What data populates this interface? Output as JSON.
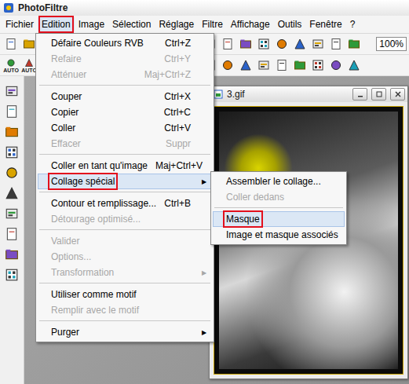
{
  "window": {
    "title": "PhotoFiltre"
  },
  "menubar": [
    {
      "label": "Fichier",
      "selected": false,
      "annotated": false
    },
    {
      "label": "Edition",
      "selected": true,
      "annotated": true
    },
    {
      "label": "Image",
      "selected": false,
      "annotated": false
    },
    {
      "label": "Sélection",
      "selected": false,
      "annotated": false
    },
    {
      "label": "Réglage",
      "selected": false,
      "annotated": false
    },
    {
      "label": "Filtre",
      "selected": false,
      "annotated": false
    },
    {
      "label": "Affichage",
      "selected": false,
      "annotated": false
    },
    {
      "label": "Outils",
      "selected": false,
      "annotated": false
    },
    {
      "label": "Fenêtre",
      "selected": false,
      "annotated": false
    },
    {
      "label": "?",
      "selected": false,
      "annotated": false
    }
  ],
  "zoom": {
    "value": "100%"
  },
  "toolbar2_badges": [
    "AUTO",
    "AUTO"
  ],
  "edit_menu": [
    {
      "kind": "item",
      "label": "Défaire Couleurs RVB",
      "shortcut": "Ctrl+Z",
      "disabled": false,
      "selected": false,
      "annotated": false
    },
    {
      "kind": "item",
      "label": "Refaire",
      "shortcut": "Ctrl+Y",
      "disabled": true,
      "selected": false,
      "annotated": false
    },
    {
      "kind": "item",
      "label": "Atténuer",
      "shortcut": "Maj+Ctrl+Z",
      "disabled": true,
      "selected": false,
      "annotated": false
    },
    {
      "kind": "separator"
    },
    {
      "kind": "item",
      "label": "Couper",
      "shortcut": "Ctrl+X",
      "disabled": false,
      "selected": false,
      "annotated": false
    },
    {
      "kind": "item",
      "label": "Copier",
      "shortcut": "Ctrl+C",
      "disabled": false,
      "selected": false,
      "annotated": false
    },
    {
      "kind": "item",
      "label": "Coller",
      "shortcut": "Ctrl+V",
      "disabled": false,
      "selected": false,
      "annotated": false
    },
    {
      "kind": "item",
      "label": "Effacer",
      "shortcut": "Suppr",
      "disabled": true,
      "selected": false,
      "annotated": false
    },
    {
      "kind": "separator"
    },
    {
      "kind": "item",
      "label": "Coller en tant qu'image",
      "shortcut": "Maj+Ctrl+V",
      "disabled": false,
      "selected": false,
      "annotated": false
    },
    {
      "kind": "submenu",
      "label": "Collage spécial",
      "arrow": "▶",
      "disabled": false,
      "selected": true,
      "annotated": true
    },
    {
      "kind": "separator"
    },
    {
      "kind": "item",
      "label": "Contour et remplissage...",
      "shortcut": "Ctrl+B",
      "disabled": false,
      "selected": false,
      "annotated": false
    },
    {
      "kind": "item",
      "label": "Détourage optimisé...",
      "shortcut": "",
      "disabled": true,
      "selected": false,
      "annotated": false
    },
    {
      "kind": "separator"
    },
    {
      "kind": "item",
      "label": "Valider",
      "shortcut": "",
      "disabled": true,
      "selected": false,
      "annotated": false
    },
    {
      "kind": "item",
      "label": "Options...",
      "shortcut": "",
      "disabled": true,
      "selected": false,
      "annotated": false
    },
    {
      "kind": "submenu",
      "label": "Transformation",
      "arrow": "▶",
      "disabled": true,
      "selected": false,
      "annotated": false
    },
    {
      "kind": "separator"
    },
    {
      "kind": "item",
      "label": "Utiliser comme motif",
      "shortcut": "",
      "disabled": false,
      "selected": false,
      "annotated": false
    },
    {
      "kind": "item",
      "label": "Remplir avec le motif",
      "shortcut": "",
      "disabled": true,
      "selected": false,
      "annotated": false
    },
    {
      "kind": "separator"
    },
    {
      "kind": "submenu",
      "label": "Purger",
      "arrow": "▶",
      "disabled": false,
      "selected": false,
      "annotated": false
    }
  ],
  "paste_submenu": [
    {
      "kind": "item",
      "label": "Assembler le collage...",
      "disabled": false,
      "selected": false,
      "annotated": false
    },
    {
      "kind": "item",
      "label": "Coller dedans",
      "disabled": true,
      "selected": false,
      "annotated": false
    },
    {
      "kind": "separator"
    },
    {
      "kind": "item",
      "label": "Masque",
      "disabled": false,
      "selected": true,
      "annotated": true
    },
    {
      "kind": "item",
      "label": "Image et masque associés",
      "disabled": false,
      "selected": false,
      "annotated": false
    }
  ],
  "document": {
    "title": "3.gif"
  }
}
